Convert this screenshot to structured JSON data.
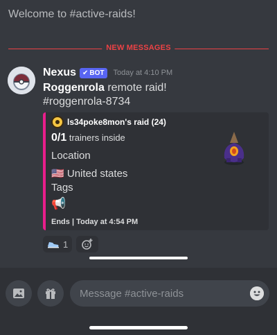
{
  "channel": {
    "welcome_text": "Welcome to #active-raids!"
  },
  "divider": {
    "label": "NEW MESSAGES"
  },
  "message": {
    "author": "Nexus",
    "bot_tag": "BOT",
    "timestamp": "Today at 4:10 PM",
    "line1_bold": "Roggenrola",
    "line1_rest": " remote raid!",
    "line2": "#roggenrola-8734"
  },
  "embed": {
    "author": "ls34poke8mon's raid (24)",
    "trainers_count": "0/1",
    "trainers_label": " trainers inside",
    "location_title": "Location",
    "location_flag": "🇺🇸",
    "location_value": "United states",
    "tags_title": "Tags",
    "tags_icon": "📢",
    "footer": "Ends | Today at 4:54 PM",
    "accent_color": "#e91e8c"
  },
  "reactions": [
    {
      "icon": "shoe-icon",
      "count": "1"
    }
  ],
  "composer": {
    "placeholder": "Message #active-raids"
  },
  "colors": {
    "background": "#36393f",
    "bot_tag": "#5865f2",
    "new_messages": "#ed4245"
  }
}
